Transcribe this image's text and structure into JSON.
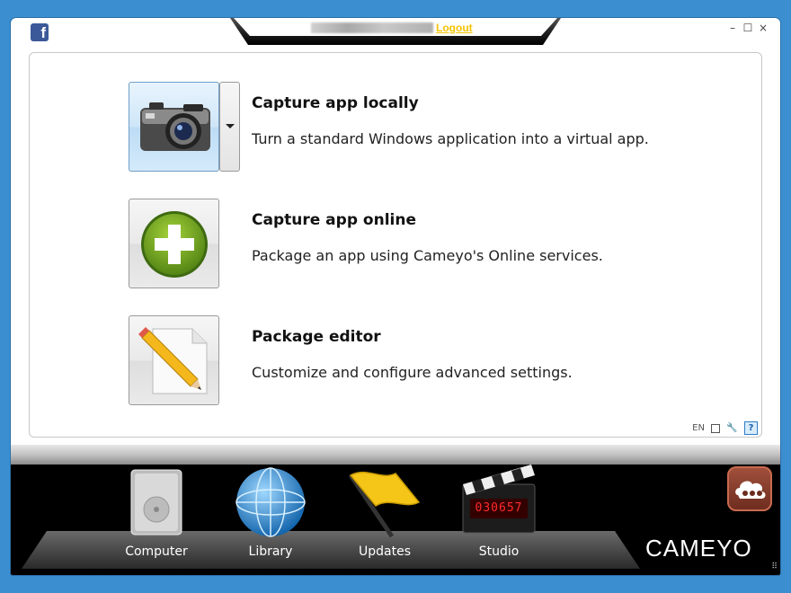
{
  "header": {
    "logout_label": "Logout"
  },
  "window_controls": {
    "minimize": "–",
    "maximize": "☐",
    "close": "×"
  },
  "options": [
    {
      "title": "Capture app locally",
      "description": "Turn a standard Windows application into a virtual app.",
      "icon": "camera-icon"
    },
    {
      "title": "Capture app online",
      "description": "Package an app using Cameyo's Online services.",
      "icon": "plus-icon"
    },
    {
      "title": "Package editor",
      "description": "Customize and configure advanced settings.",
      "icon": "pencil-document-icon"
    }
  ],
  "status_bar": {
    "language": "EN",
    "help": "?"
  },
  "dock": {
    "items": [
      {
        "label": "Computer",
        "icon": "hard-drive-icon"
      },
      {
        "label": "Library",
        "icon": "globe-icon"
      },
      {
        "label": "Updates",
        "icon": "flag-icon"
      },
      {
        "label": "Studio",
        "icon": "clapperboard-icon"
      }
    ],
    "clapper_digits": "030657",
    "logo": "CAMEYO"
  },
  "colors": {
    "background": "#3b8fd0",
    "logout": "#f3c300",
    "dock": "#000000"
  }
}
